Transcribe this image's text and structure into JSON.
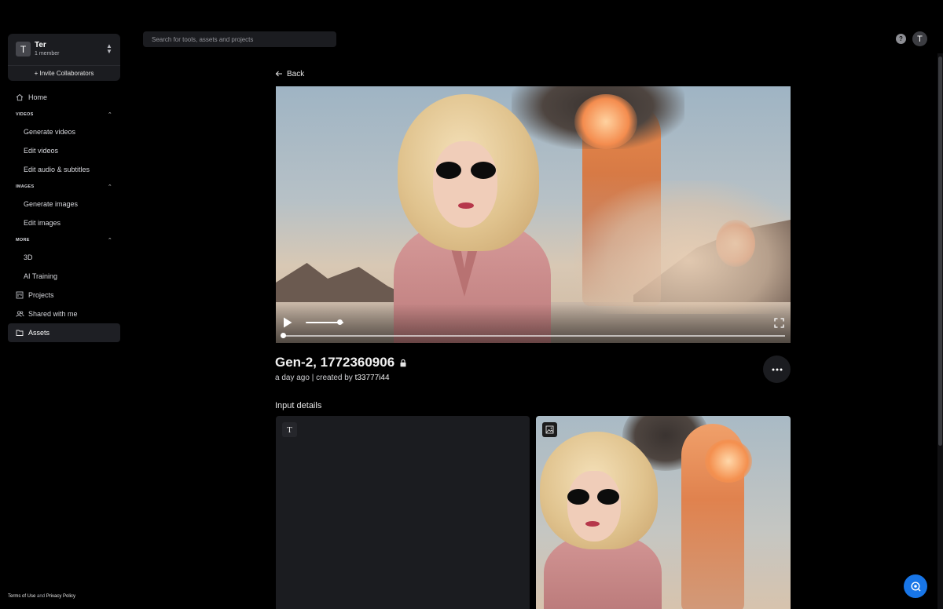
{
  "workspace": {
    "avatar_letter": "T",
    "name": "Ter",
    "members": "1 member",
    "invite_label": "+ Invite Collaborators"
  },
  "nav": {
    "home": "Home",
    "videos_section": "VIDEOS",
    "generate_videos": "Generate videos",
    "edit_videos": "Edit videos",
    "edit_audio": "Edit audio & subtitles",
    "images_section": "IMAGES",
    "generate_images": "Generate images",
    "edit_images": "Edit images",
    "more_section": "MORE",
    "three_d": "3D",
    "ai_training": "AI Training",
    "projects": "Projects",
    "shared": "Shared with me",
    "assets": "Assets"
  },
  "legal": {
    "terms": "Terms of Use",
    "and": "and",
    "privacy": "Privacy Policy"
  },
  "search": {
    "placeholder": "Search for tools, assets and projects"
  },
  "user": {
    "avatar_letter": "T"
  },
  "asset": {
    "back_label": "Back",
    "title": "Gen-2, 1772360906",
    "time": "a day ago",
    "separator": "|",
    "created_by": "created by",
    "creator": "t33777i44",
    "input_details": "Input details",
    "text_icon_glyph": "T"
  },
  "player": {
    "volume_level": 0.9,
    "progress": 0.0
  },
  "colors": {
    "background": "#000000",
    "panel": "#1b1c20",
    "chat_button": "#1876e8"
  }
}
